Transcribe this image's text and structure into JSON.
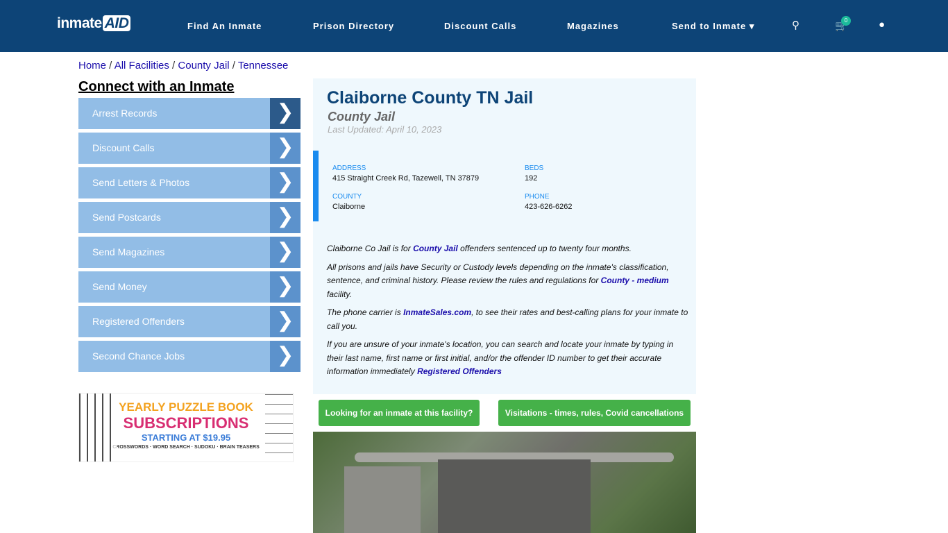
{
  "nav": {
    "logo": "inmateAID",
    "logo_main": "inmate",
    "logo_accent": "AID",
    "links": [
      "Find An Inmate",
      "Prison Directory",
      "Discount Calls",
      "Magazines",
      "Send to Inmate"
    ],
    "cart_count": "0"
  },
  "breadcrumb": [
    "Home",
    "All Facilities",
    "County Jail",
    "Tennessee"
  ],
  "sidebar": {
    "heading": "Connect with an Inmate",
    "items": [
      "Arrest Records",
      "Discount Calls",
      "Send Letters & Photos",
      "Send Postcards",
      "Send Magazines",
      "Send Money",
      "Registered Offenders",
      "Second Chance Jobs"
    ]
  },
  "ad": {
    "line1": "YEARLY PUZZLE BOOK",
    "line2": "SUBSCRIPTIONS",
    "line3": "STARTING AT $19.95",
    "line4": "CROSSWORDS · WORD SEARCH · SUDOKU · BRAIN TEASERS"
  },
  "facility": {
    "title": "Claiborne County TN Jail",
    "type": "County Jail",
    "updated": "Last Updated: April 10, 2023",
    "address_label": "ADDRESS",
    "address": "415 Straight Creek Rd, Tazewell, TN 37879",
    "beds_label": "BEDS",
    "beds": "192",
    "county_label": "COUNTY",
    "county": "Claiborne",
    "phone_label": "PHONE",
    "phone": "423-626-6262"
  },
  "description": {
    "p1a": "Claiborne Co Jail is for ",
    "p1link": "County Jail",
    "p1b": " offenders sentenced up to twenty four months.",
    "p2a": "All prisons and jails have Security or Custody levels depending on the inmate's classification, sentence, and criminal history. Please review the rules and regulations for ",
    "p2link": "County - medium",
    "p2b": " facility.",
    "p3a": "The phone carrier is ",
    "p3link": "InmateSales.com",
    "p3b": ", to see their rates and best-calling plans for your inmate to call you.",
    "p4a": "If you are unsure of your inmate's location, you can search and locate your inmate by typing in their last name, first name or first initial, and/or the offender ID number to get their accurate information immediately ",
    "p4link": "Registered Offenders"
  },
  "buttons": {
    "looking": "Looking for an inmate at this facility?",
    "visitations": "Visitations - times, rules, Covid cancellations"
  },
  "colors": {
    "nav": "#0d4477",
    "sidebar": "#92bde6",
    "button": "#45b149",
    "accent": "#1a8bef"
  }
}
